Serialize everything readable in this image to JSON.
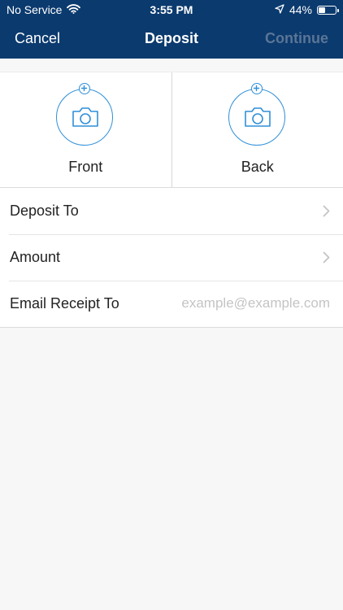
{
  "status_bar": {
    "carrier": "No Service",
    "time": "3:55 PM",
    "battery_percent": "44%",
    "battery_level": 0.44,
    "icons": [
      "wifi-icon",
      "location-arrow-icon",
      "battery-icon"
    ]
  },
  "nav": {
    "left_label": "Cancel",
    "title": "Deposit",
    "right_label": "Continue"
  },
  "capture": {
    "front_label": "Front",
    "back_label": "Back",
    "icon": "camera-icon",
    "badge_icon": "plus-icon"
  },
  "form": {
    "deposit_to_label": "Deposit To",
    "amount_label": "Amount",
    "email_label": "Email Receipt To",
    "email_placeholder": "example@example.com",
    "email_value": ""
  },
  "colors": {
    "header_bg": "#0b3a6e",
    "accent": "#2f8fd8",
    "disabled_action": "#5a7595",
    "page_bg": "#f7f7f7"
  }
}
